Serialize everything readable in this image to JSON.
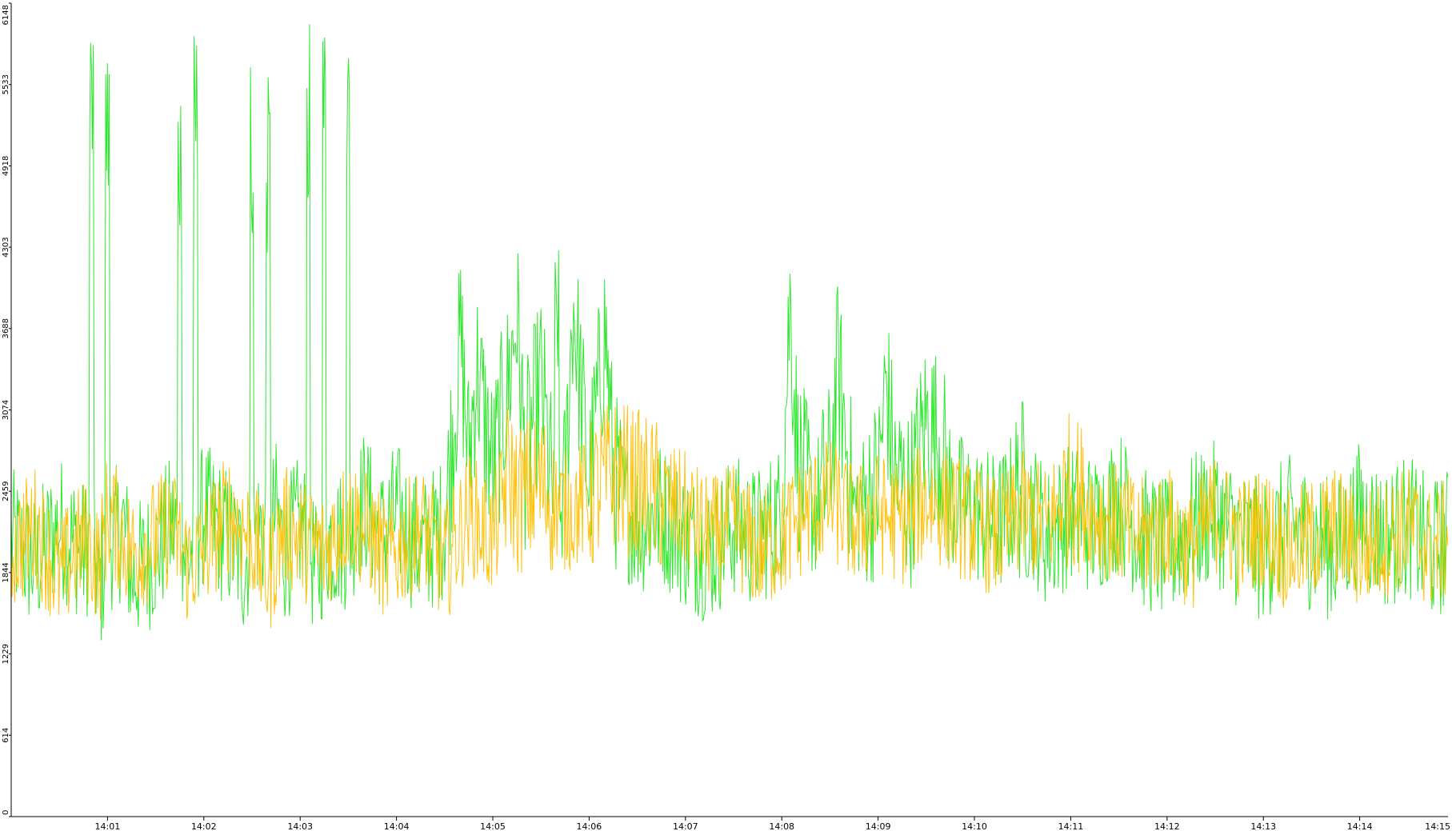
{
  "colors": {
    "background": "#ffffff",
    "axis": "#000000",
    "green_series": "#2ee82e",
    "orange_series": "#ffc20e"
  },
  "chart_data": {
    "type": "line",
    "title": "",
    "xlabel": "",
    "ylabel": "",
    "grid": false,
    "legend": "none",
    "ylim": [
      0,
      6148
    ],
    "xlim": [
      "14:00:00",
      "14:14:55"
    ],
    "y_ticks": [
      "0",
      "614",
      "1229",
      "1844",
      "2459",
      "3074",
      "3688",
      "4303",
      "4918",
      "5533",
      "6148"
    ],
    "x_ticks": [
      "14:01",
      "14:02",
      "14:03",
      "14:04",
      "14:05",
      "14:06",
      "14:07",
      "14:08",
      "14:09",
      "14:10",
      "14:11",
      "14:12",
      "14:13",
      "14:14",
      "14:15"
    ],
    "x_tick_times": [
      "14:01:00",
      "14:02:00",
      "14:03:00",
      "14:04:00",
      "14:05:00",
      "14:06:00",
      "14:07:00",
      "14:08:00",
      "14:09:00",
      "14:10:00",
      "14:11:00",
      "14:12:00",
      "14:13:00",
      "14:14:00",
      "14:15:00"
    ],
    "series": [
      {
        "color": "#2ee82e",
        "x": [
          "14:00:00",
          "14:00:15",
          "14:00:30",
          "14:00:45",
          "14:00:50",
          "14:00:55",
          "14:01:00",
          "14:01:05",
          "14:01:10",
          "14:01:15",
          "14:01:30",
          "14:01:40",
          "14:01:45",
          "14:01:50",
          "14:01:55",
          "14:02:00",
          "14:02:15",
          "14:02:25",
          "14:02:30",
          "14:02:35",
          "14:02:40",
          "14:02:45",
          "14:02:50",
          "14:03:00",
          "14:03:05",
          "14:03:10",
          "14:03:15",
          "14:03:20",
          "14:03:30",
          "14:03:40",
          "14:03:50",
          "14:04:00",
          "14:04:15",
          "14:04:30",
          "14:04:40",
          "14:04:45",
          "14:04:50",
          "14:05:00",
          "14:05:10",
          "14:05:15",
          "14:05:20",
          "14:05:30",
          "14:05:40",
          "14:05:45",
          "14:05:50",
          "14:06:00",
          "14:06:10",
          "14:06:15",
          "14:06:20",
          "14:06:30",
          "14:06:45",
          "14:07:00",
          "14:07:15",
          "14:07:30",
          "14:07:45",
          "14:08:00",
          "14:08:05",
          "14:08:10",
          "14:08:20",
          "14:08:30",
          "14:08:35",
          "14:08:45",
          "14:09:00",
          "14:09:05",
          "14:09:10",
          "14:09:20",
          "14:09:30",
          "14:09:40",
          "14:09:45",
          "14:10:00",
          "14:10:15",
          "14:10:30",
          "14:10:45",
          "14:11:00",
          "14:11:15",
          "14:11:30",
          "14:11:45",
          "14:12:00",
          "14:12:15",
          "14:12:30",
          "14:12:45",
          "14:13:00",
          "14:13:15",
          "14:13:30",
          "14:13:45",
          "14:14:00",
          "14:14:15",
          "14:14:30",
          "14:14:45",
          "14:14:55"
        ],
        "y": [
          2100,
          1900,
          2200,
          2000,
          6148,
          1700,
          5900,
          2100,
          2200,
          1800,
          2000,
          2200,
          5700,
          1900,
          6000,
          2300,
          2100,
          1900,
          5800,
          2200,
          5600,
          2300,
          2000,
          2200,
          6000,
          1800,
          6100,
          2100,
          6000,
          2400,
          2100,
          2300,
          2000,
          2200,
          3600,
          2700,
          3400,
          2600,
          3300,
          3800,
          2700,
          3300,
          4300,
          2500,
          3900,
          2500,
          3700,
          2600,
          2400,
          2200,
          2300,
          2100,
          2000,
          2200,
          2100,
          2300,
          3900,
          2700,
          2300,
          2600,
          3400,
          2300,
          2500,
          3300,
          2600,
          2400,
          3000,
          2800,
          2400,
          2300,
          2200,
          2500,
          2100,
          2300,
          2200,
          2400,
          2100,
          2000,
          2200,
          2300,
          2100,
          2000,
          2200,
          2100,
          2000,
          2300,
          2100,
          2200,
          2000,
          2100
        ]
      },
      {
        "color": "#ffc20e",
        "x": [
          "14:00:00",
          "14:00:15",
          "14:00:30",
          "14:00:45",
          "14:00:55",
          "14:01:00",
          "14:01:15",
          "14:01:30",
          "14:01:40",
          "14:01:50",
          "14:02:00",
          "14:02:15",
          "14:02:30",
          "14:02:40",
          "14:02:50",
          "14:03:00",
          "14:03:15",
          "14:03:30",
          "14:03:45",
          "14:03:55",
          "14:04:00",
          "14:04:15",
          "14:04:30",
          "14:04:45",
          "14:05:00",
          "14:05:10",
          "14:05:15",
          "14:05:30",
          "14:05:45",
          "14:06:00",
          "14:06:15",
          "14:06:30",
          "14:06:45",
          "14:07:00",
          "14:07:15",
          "14:07:30",
          "14:07:45",
          "14:08:00",
          "14:08:15",
          "14:08:30",
          "14:08:45",
          "14:09:00",
          "14:09:15",
          "14:09:30",
          "14:09:45",
          "14:10:00",
          "14:10:15",
          "14:10:30",
          "14:10:45",
          "14:11:00",
          "14:11:15",
          "14:11:30",
          "14:11:45",
          "14:12:00",
          "14:12:15",
          "14:12:30",
          "14:12:45",
          "14:13:00",
          "14:13:15",
          "14:13:30",
          "14:13:45",
          "14:14:00",
          "14:14:15",
          "14:14:30",
          "14:14:45",
          "14:14:55"
        ],
        "y": [
          2000,
          2200,
          1800,
          2100,
          1900,
          2300,
          2000,
          2100,
          2200,
          1900,
          2000,
          2300,
          2100,
          1800,
          2200,
          2100,
          2000,
          2300,
          2100,
          1900,
          2000,
          2200,
          1900,
          2300,
          2100,
          2600,
          2400,
          2500,
          2300,
          2400,
          2600,
          2500,
          2400,
          2300,
          2100,
          2200,
          2000,
          2100,
          2300,
          2400,
          2200,
          2300,
          2200,
          2400,
          2300,
          2200,
          2100,
          2300,
          2200,
          2500,
          2300,
          2200,
          2100,
          2200,
          2000,
          2300,
          2100,
          2200,
          2000,
          2100,
          2200,
          2000,
          2100,
          2200,
          2000,
          2100
        ]
      }
    ]
  }
}
